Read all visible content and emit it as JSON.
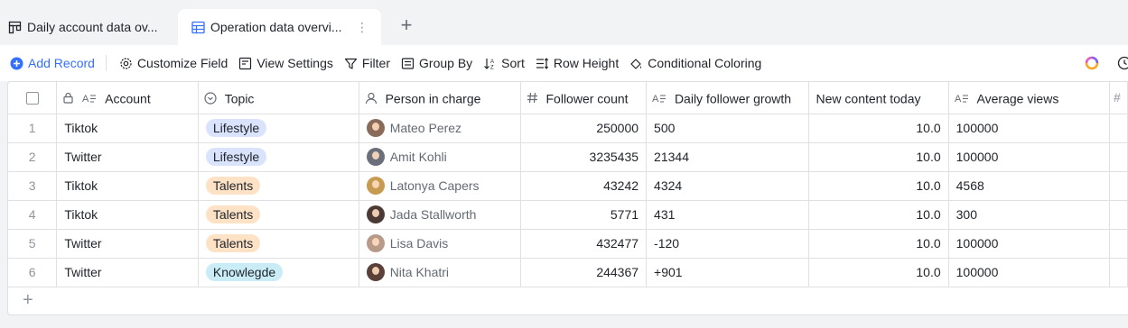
{
  "tabs": [
    {
      "label": "Daily account data ov...",
      "icon": "board-icon",
      "active": false
    },
    {
      "label": "Operation data overvi...",
      "icon": "grid-table-icon",
      "active": true
    }
  ],
  "toolbar": {
    "add_record": "Add Record",
    "customize_field": "Customize Field",
    "view_settings": "View Settings",
    "filter": "Filter",
    "group_by": "Group By",
    "sort": "Sort",
    "row_height": "Row Height",
    "conditional_coloring": "Conditional Coloring"
  },
  "columns": [
    {
      "label": "Account",
      "icon": "text-field-icon"
    },
    {
      "label": "Topic",
      "icon": "single-select-icon"
    },
    {
      "label": "Person in charge",
      "icon": "person-icon"
    },
    {
      "label": "Follower count",
      "icon": "number-icon"
    },
    {
      "label": "Daily follower growth",
      "icon": "text-field-icon"
    },
    {
      "label": "New content today",
      "icon": ""
    },
    {
      "label": "Average views",
      "icon": "text-field-icon"
    }
  ],
  "rows": [
    {
      "n": "1",
      "account": "Tiktok",
      "topic": "Lifestyle",
      "topic_color": "#d9e3fb",
      "person": "Mateo Perez",
      "avatar_color": "#8a6a58",
      "followers": "250000",
      "growth": "500",
      "new_content": "10.0",
      "avg_views": "100000"
    },
    {
      "n": "2",
      "account": "Twitter",
      "topic": "Lifestyle",
      "topic_color": "#d9e3fb",
      "person": "Amit Kohli",
      "avatar_color": "#6b6f7a",
      "followers": "3235435",
      "growth": "21344",
      "new_content": "10.0",
      "avg_views": "100000"
    },
    {
      "n": "3",
      "account": "Tiktok",
      "topic": "Talents",
      "topic_color": "#fde2c6",
      "person": "Latonya Capers",
      "avatar_color": "#c79a52",
      "followers": "43242",
      "growth": "4324",
      "new_content": "10.0",
      "avg_views": "4568"
    },
    {
      "n": "4",
      "account": "Tiktok",
      "topic": "Talents",
      "topic_color": "#fde2c6",
      "person": "Jada Stallworth",
      "avatar_color": "#4b3a33",
      "followers": "5771",
      "growth": "431",
      "new_content": "10.0",
      "avg_views": "300"
    },
    {
      "n": "5",
      "account": "Twitter",
      "topic": "Talents",
      "topic_color": "#fde2c6",
      "person": "Lisa Davis",
      "avatar_color": "#b89a88",
      "followers": "432477",
      "growth": "-120",
      "new_content": "10.0",
      "avg_views": "100000"
    },
    {
      "n": "6",
      "account": "Twitter",
      "topic": "Knowlegde",
      "topic_color": "#c9ecf6",
      "person": "Nita Khatri",
      "avatar_color": "#5a4038",
      "followers": "244367",
      "growth": "+901",
      "new_content": "10.0",
      "avg_views": "100000"
    }
  ]
}
